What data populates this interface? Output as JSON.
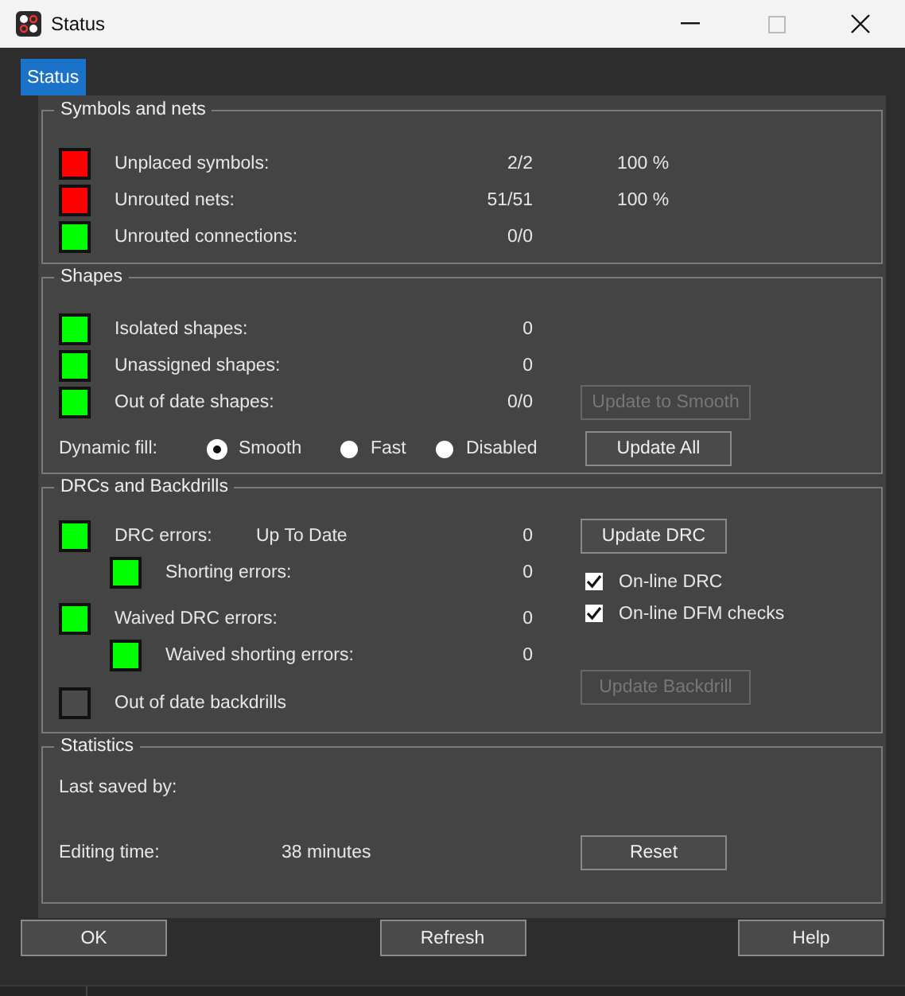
{
  "window": {
    "title": "Status"
  },
  "tabs": [
    {
      "label": "Status",
      "selected": true
    }
  ],
  "symbols_and_nets": {
    "title": "Symbols and nets",
    "rows": [
      {
        "label": "Unplaced symbols:",
        "value": "2/2",
        "percent": "100 %",
        "color": "#ff0000"
      },
      {
        "label": "Unrouted nets:",
        "value": "51/51",
        "percent": "100 %",
        "color": "#ff0000"
      },
      {
        "label": "Unrouted connections:",
        "value": "0/0",
        "color": "#00ff00"
      }
    ]
  },
  "shapes": {
    "title": "Shapes",
    "rows": [
      {
        "label": "Isolated shapes:",
        "value": "0",
        "color": "#00ff00"
      },
      {
        "label": "Unassigned shapes:",
        "value": "0",
        "color": "#00ff00"
      },
      {
        "label": "Out of date shapes:",
        "value": "0/0",
        "color": "#00ff00"
      }
    ],
    "update_to_smooth": {
      "label": "Update to Smooth",
      "disabled": true
    },
    "dynamic_fill": {
      "label": "Dynamic fill:",
      "options": [
        {
          "label": "Smooth",
          "selected": true
        },
        {
          "label": "Fast",
          "selected": false
        },
        {
          "label": "Disabled",
          "selected": false
        }
      ]
    },
    "update_all": {
      "label": "Update All",
      "disabled": false
    }
  },
  "drcs_and_backdrills": {
    "title": "DRCs and Backdrills",
    "rows": [
      {
        "label": "DRC errors:",
        "status": "Up To Date",
        "value": "0",
        "color": "#00ff00",
        "children": [
          {
            "label": "Shorting errors:",
            "value": "0",
            "color": "#00ff00"
          }
        ]
      },
      {
        "label": "Waived DRC errors:",
        "value": "0",
        "color": "#00ff00",
        "children": [
          {
            "label": "Waived shorting errors:",
            "value": "0",
            "color": "#00ff00"
          }
        ]
      },
      {
        "label": "Out of date backdrills",
        "color": "#4a4a4a"
      }
    ],
    "update_drc": {
      "label": "Update DRC",
      "disabled": false
    },
    "checkboxes": [
      {
        "label": "On-line DRC",
        "checked": true
      },
      {
        "label": "On-line DFM checks",
        "checked": true
      }
    ],
    "update_backdrill": {
      "label": "Update Backdrill",
      "disabled": true
    }
  },
  "statistics": {
    "title": "Statistics",
    "last_saved_by": {
      "label": "Last saved by:"
    },
    "editing_time": {
      "label": "Editing time:",
      "value": "38 minutes"
    },
    "reset": {
      "label": "Reset"
    }
  },
  "buttons": [
    {
      "label": "OK"
    },
    {
      "label": "Refresh"
    },
    {
      "label": "Help"
    }
  ]
}
